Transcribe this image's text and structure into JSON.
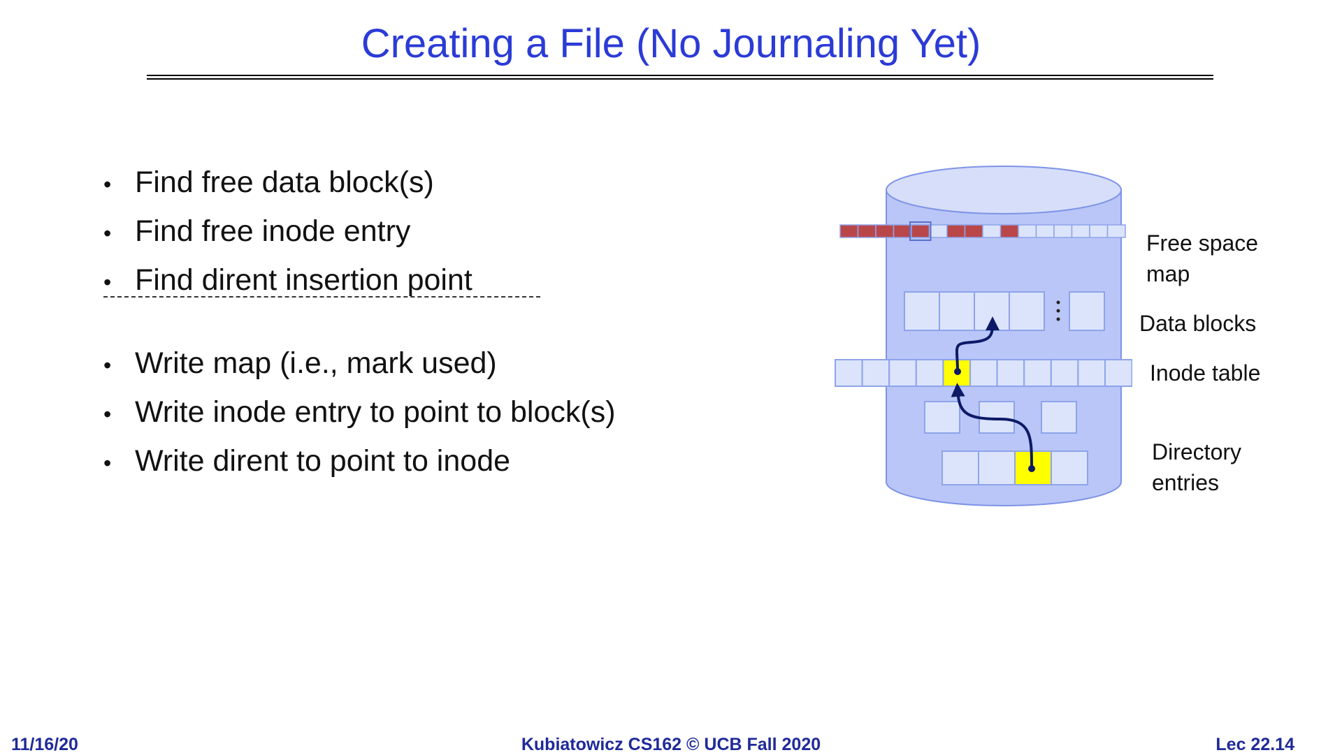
{
  "slide": {
    "title": "Creating a File (No Journaling Yet)"
  },
  "steps_find": [
    "Find free data block(s)",
    "Find free inode entry",
    "Find dirent insertion point"
  ],
  "separator": "----------------------------------------",
  "steps_write": [
    "Write map (i.e., mark used)",
    "Write inode entry to point to block(s)",
    "Write dirent to point to inode"
  ],
  "diagram": {
    "labels": {
      "free_space_map_line1": "Free space",
      "free_space_map_line2": "map",
      "data_blocks": "Data blocks",
      "inode_table": "Inode table",
      "directory_entries_line1": "Directory",
      "directory_entries_line2": "entries"
    },
    "free_space_map_used": [
      true,
      true,
      true,
      true,
      true,
      false,
      true,
      true,
      false,
      true,
      false,
      false,
      false,
      false,
      false,
      false
    ],
    "colors": {
      "cylinder_fill": "#b9c6f7",
      "cylinder_top": "#d6def9",
      "cell_fill": "#dbe4fb",
      "used_cell": "#b9474a",
      "highlight": "#ffff00",
      "arrow": "#0d1a66"
    }
  },
  "footer": {
    "date": "11/16/20",
    "course": "Kubiatowicz CS162 © UCB Fall 2020",
    "lecture": "Lec 22.14"
  }
}
